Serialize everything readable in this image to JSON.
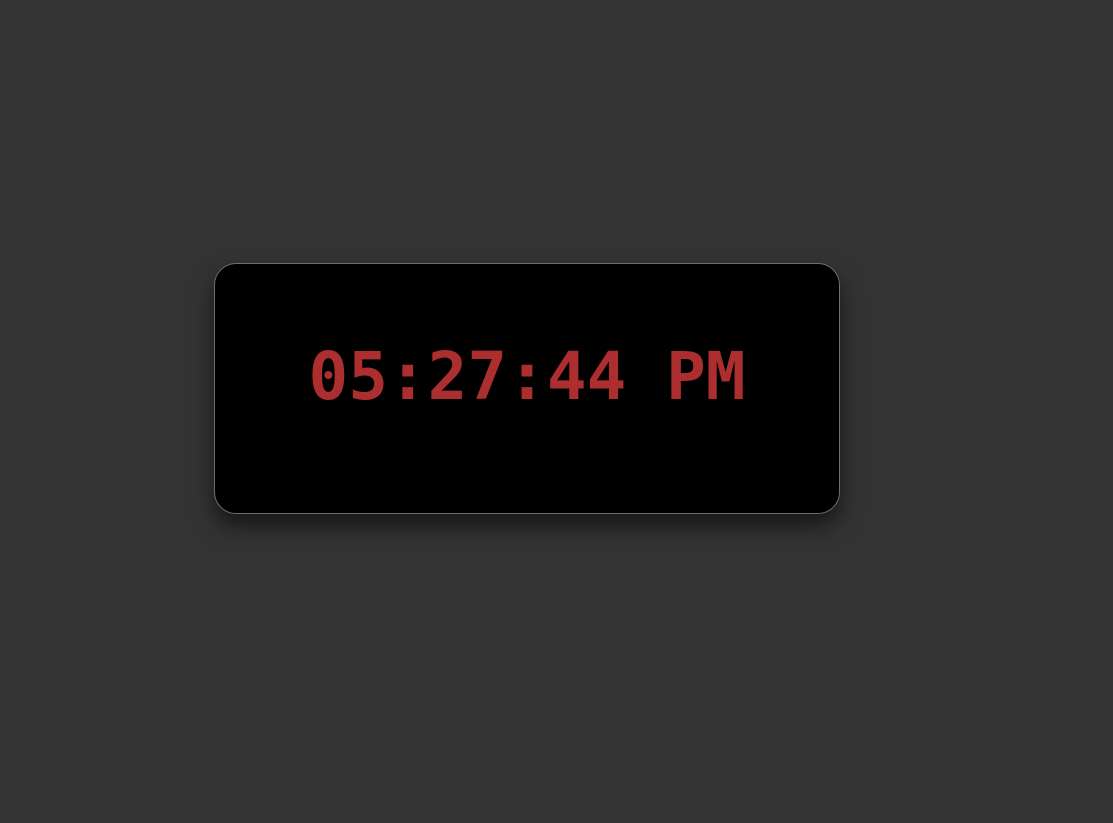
{
  "clock": {
    "time_text": "05:27:44 PM"
  },
  "colors": {
    "background": "#333333",
    "panel": "#000000",
    "panel_border": "#6e6e6e",
    "digits": "#ac2e2e"
  }
}
